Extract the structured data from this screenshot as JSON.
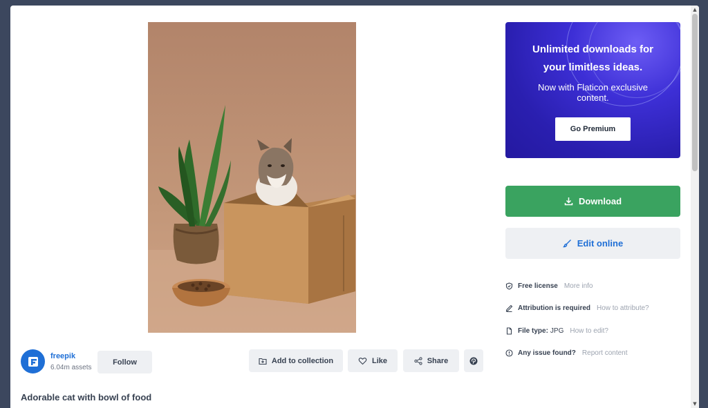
{
  "premium": {
    "heading": "Unlimited downloads for your limitless ideas.",
    "subtext": "Now with Flaticon exclusive content.",
    "button": "Go Premium"
  },
  "actions": {
    "download": "Download",
    "edit_online": "Edit online"
  },
  "info": {
    "license": {
      "label": "Free license",
      "link": "More info"
    },
    "attribution": {
      "label": "Attribution is required",
      "link": "How to attribute?"
    },
    "file_type": {
      "label": "File type:",
      "value": "JPG",
      "link": "How to edit?"
    },
    "issue": {
      "label": "Any issue found?",
      "link": "Report content"
    }
  },
  "author": {
    "name": "freepik",
    "assets": "6.04m assets",
    "follow": "Follow"
  },
  "toolbar": {
    "add_collection": "Add to collection",
    "like": "Like",
    "share": "Share"
  },
  "resource": {
    "title": "Adorable cat with bowl of food"
  },
  "colors": {
    "download_green": "#3aa360",
    "link_blue": "#1f6fd6",
    "premium_purple": "#3d2fd6"
  },
  "icons": [
    "download-icon",
    "brush-icon",
    "shield-icon",
    "pen-icon",
    "file-icon",
    "info-icon",
    "collection-icon",
    "heart-icon",
    "share-icon",
    "pinterest-icon"
  ]
}
